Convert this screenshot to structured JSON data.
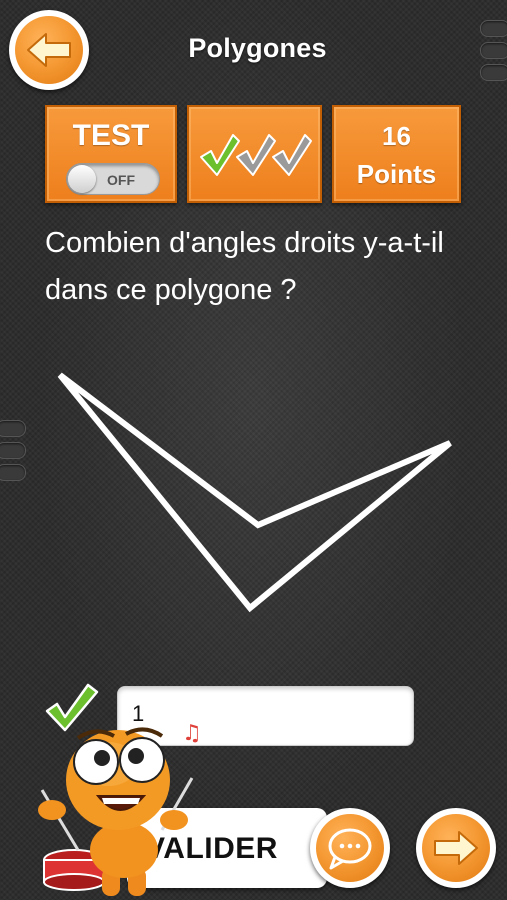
{
  "header": {
    "title": "Polygones"
  },
  "score_panel": {
    "test_label": "TEST",
    "toggle_state": "OFF",
    "checks_total": 3,
    "checks_done": 1,
    "points_value": "16",
    "points_label": "Points"
  },
  "question": {
    "text": "Combien d'angles droits y-a-t-il dans ce polygone ?"
  },
  "answer": {
    "value": "1",
    "correct": true
  },
  "actions": {
    "validate_label": "VALIDER",
    "hint_icon": "speech-bubble-icon",
    "next_icon": "arrow-right-icon",
    "back_icon": "arrow-left-icon"
  },
  "colors": {
    "accent_orange": "#f18a2b",
    "check_green": "#6cc02e",
    "check_gray": "#9a9a9a"
  }
}
